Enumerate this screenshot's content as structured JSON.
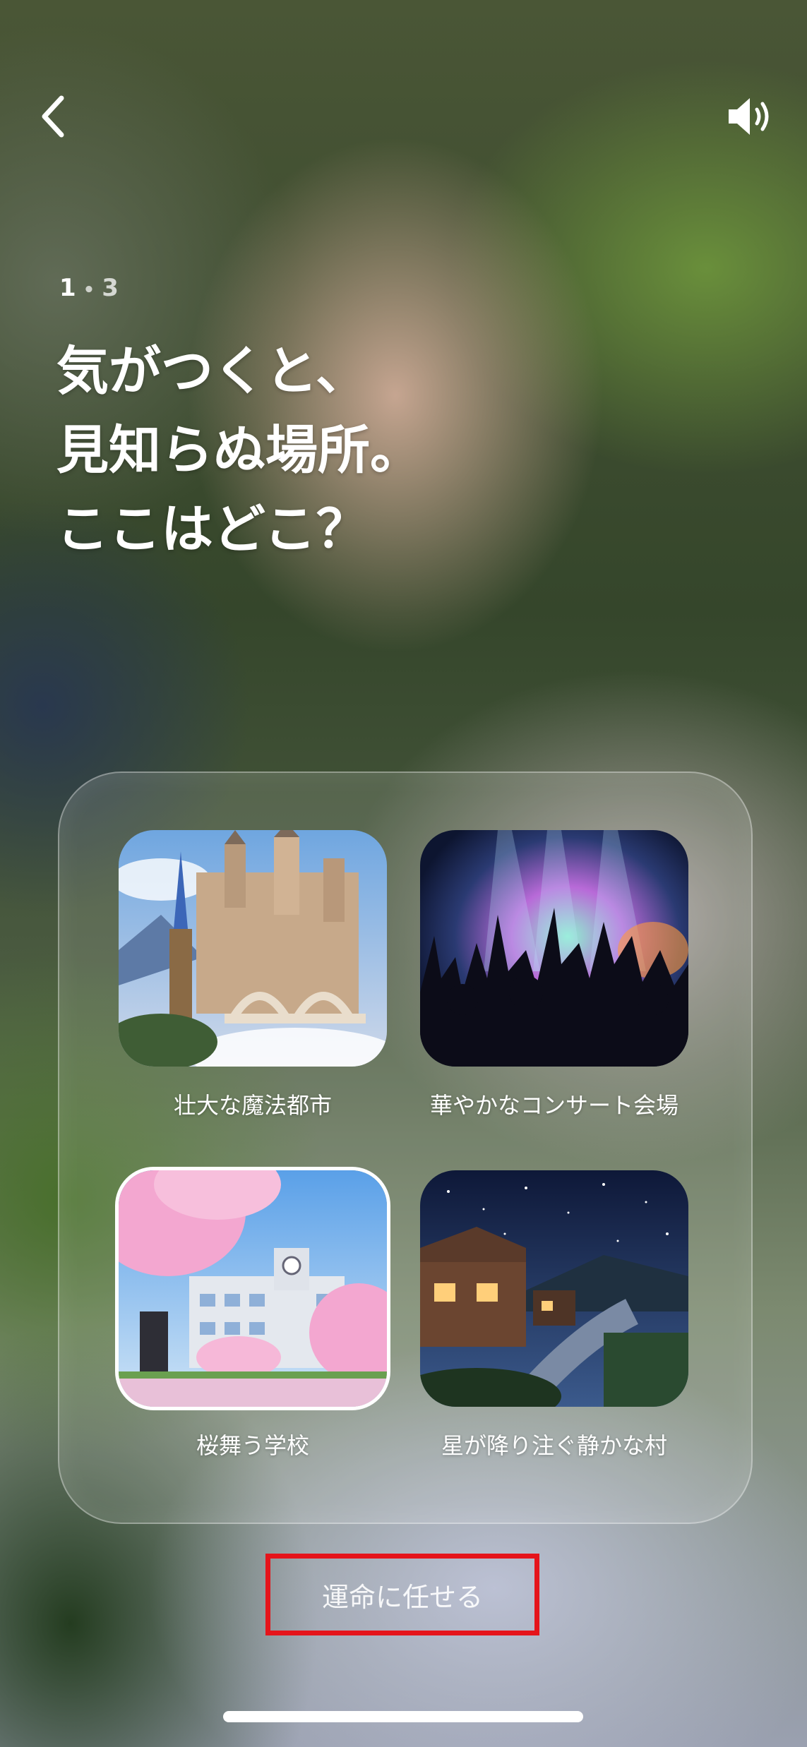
{
  "header": {
    "back_icon": "chevron-left-icon",
    "sound_icon": "speaker-volume-icon"
  },
  "progress": {
    "current": "1",
    "separator": "•",
    "total": "3"
  },
  "question": {
    "lines": [
      "気がつくと、",
      "見知らぬ場所。",
      "ここはどこ？"
    ]
  },
  "options": [
    {
      "label": "壮大な魔法都市",
      "selected": false
    },
    {
      "label": "華やかなコンサート会場",
      "selected": false
    },
    {
      "label": "桜舞う学校",
      "selected": true
    },
    {
      "label": "星が降り注ぐ静かな村",
      "selected": false
    }
  ],
  "fate_button": {
    "label": "運命に任せる"
  },
  "colors": {
    "highlight_border": "#e5141b",
    "selected_ring": "#ffffff"
  }
}
